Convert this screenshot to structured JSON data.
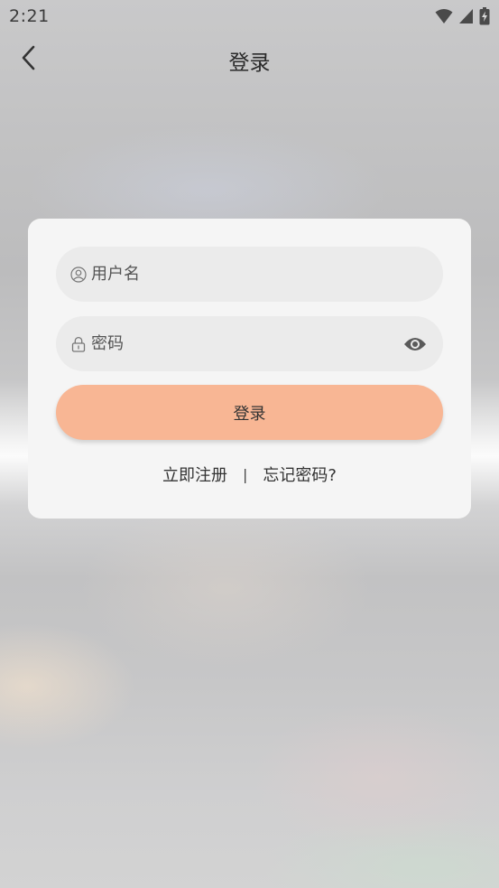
{
  "status_bar": {
    "time": "2:21"
  },
  "app_bar": {
    "title": "登录"
  },
  "login_form": {
    "username": {
      "placeholder": "用户名",
      "value": ""
    },
    "password": {
      "placeholder": "密码",
      "value": ""
    },
    "submit_label": "登录",
    "register_link": "立即注册",
    "separator": "|",
    "forgot_link": "忘记密码?"
  },
  "icons": {
    "back": "chevron-left-icon",
    "user": "user-circle-icon",
    "lock": "lock-icon",
    "eye": "eye-icon",
    "wifi": "wifi-icon",
    "signal": "signal-icon",
    "battery": "battery-charging-icon"
  },
  "colors": {
    "accent_button": "#f8b694",
    "card_background": "#f5f5f5",
    "input_background": "#ebebeb"
  }
}
